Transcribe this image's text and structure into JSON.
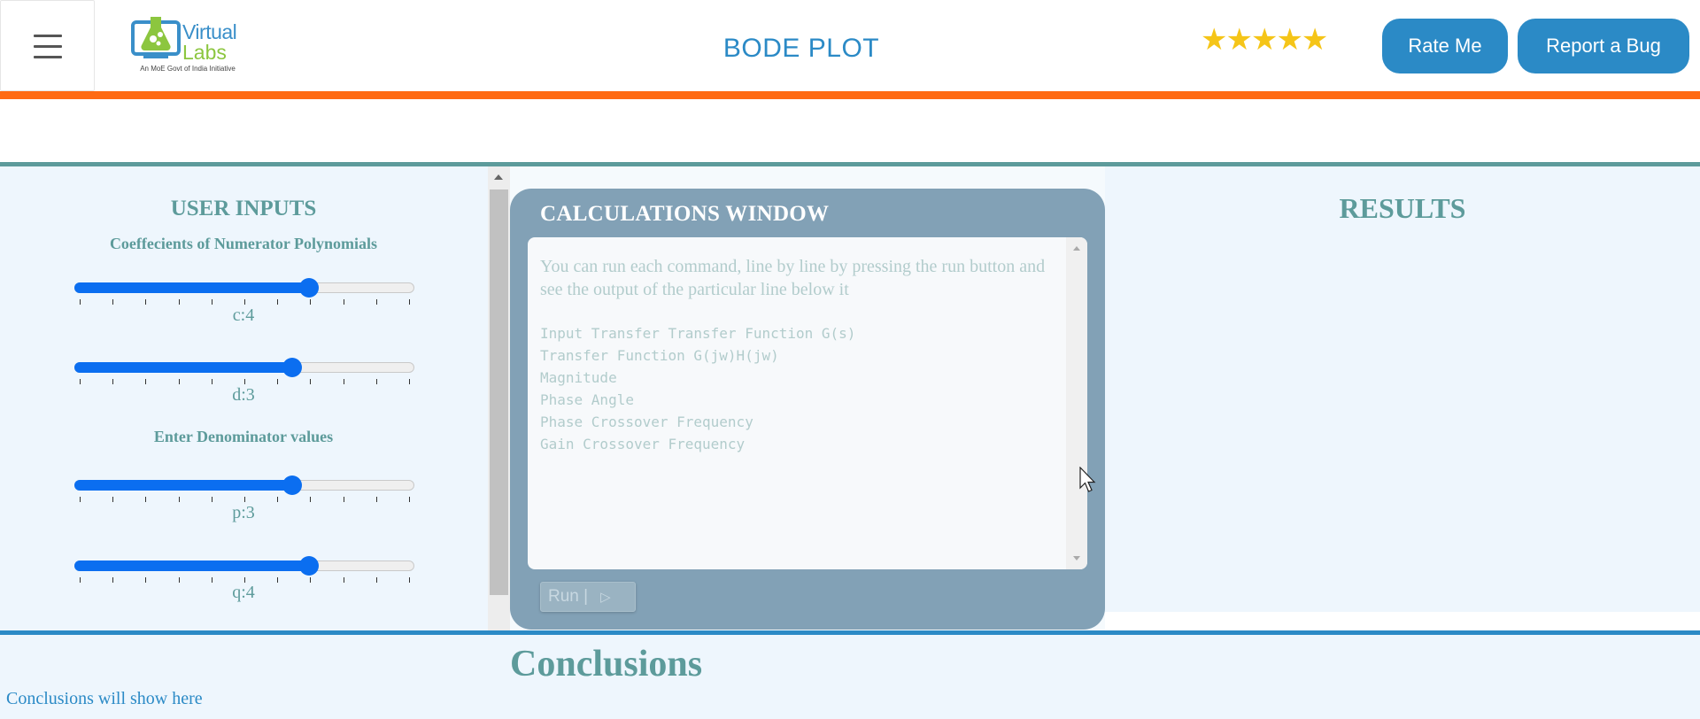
{
  "header": {
    "logo": {
      "name": "Virtual",
      "sub": "Labs",
      "tagline": "An MoE Govt of India Initiative"
    },
    "title": "BODE PLOT",
    "rating": {
      "stars": 5,
      "glyphs": "★★★★★",
      "color": "#f5c518"
    },
    "rate_label": "Rate Me",
    "bug_label": "Report a Bug",
    "accent_color": "#ff6a13",
    "button_color": "#2b8ac6"
  },
  "inputs": {
    "title": "USER INPUTS",
    "numerator_title": "Coeffecients of Numerator Polynomials",
    "denominator_title": "Enter Denominator values",
    "sliders": [
      {
        "id": "c",
        "label": "c:4",
        "value": 4
      },
      {
        "id": "d",
        "label": "d:3",
        "value": 3
      },
      {
        "id": "p",
        "label": "p:3",
        "value": 3
      },
      {
        "id": "q",
        "label": "q:4",
        "value": 4
      }
    ],
    "slider_color": "#0b6ef0"
  },
  "calculations": {
    "title": "CALCULATIONS WINDOW",
    "hint": "You can run each command, line by line by pressing the run button and see the output of the particular line below it",
    "lines": [
      "Input Transfer Transfer Function G(s)",
      "Transfer Function G(jw)H(jw)",
      "Magnitude",
      "Phase Angle",
      "Phase Crossover Frequency",
      "Gain Crossover Frequency"
    ],
    "run_label": "Run |",
    "run_icon": "play-icon"
  },
  "results": {
    "title": "RESULTS"
  },
  "conclusions": {
    "title": "Conclusions",
    "text": "Conclusions will show here"
  }
}
